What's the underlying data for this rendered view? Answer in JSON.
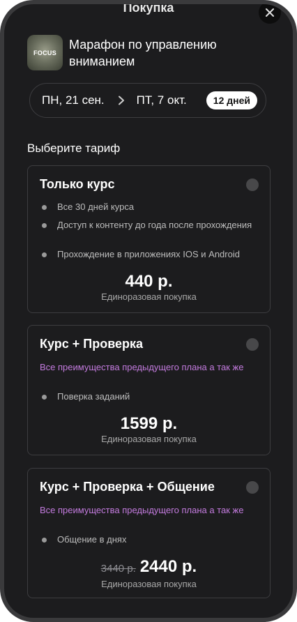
{
  "sheet": {
    "title": "Покупка",
    "close_icon": "close-icon"
  },
  "course": {
    "thumb_text": "FOCUS",
    "title": "Марафон по управлению вниманием"
  },
  "dates": {
    "start": "ПН, 21 сен.",
    "end": "ПТ, 7 окт.",
    "duration": "12 дней"
  },
  "section_title": "Выберите тариф",
  "plans": [
    {
      "name": "Только курс",
      "perks": [
        "Все 30 дней курса",
        "Доступ к контенту до года после прохождения",
        "Прохождение в приложениях IOS и Android"
      ],
      "price": "440 р.",
      "price_note": "Единоразовая покупка"
    },
    {
      "name": "Курс + Проверка",
      "highlight": "Все преимущества предыдущего плана а так же",
      "perks": [
        "Поверка заданий"
      ],
      "price": "1599 р.",
      "price_note": "Единоразовая покупка"
    },
    {
      "name": "Курс + Проверка + Общение",
      "highlight": "Все преимущества предыдущего плана а так же",
      "perks": [
        "Общение в днях"
      ],
      "old_price": "3440 р.",
      "price": "2440 р.",
      "price_note": "Единоразовая покупка"
    }
  ],
  "colors": {
    "background": "#1c1c1e",
    "accent_highlight": "#c37bde",
    "card_border": "#3d3d40"
  }
}
